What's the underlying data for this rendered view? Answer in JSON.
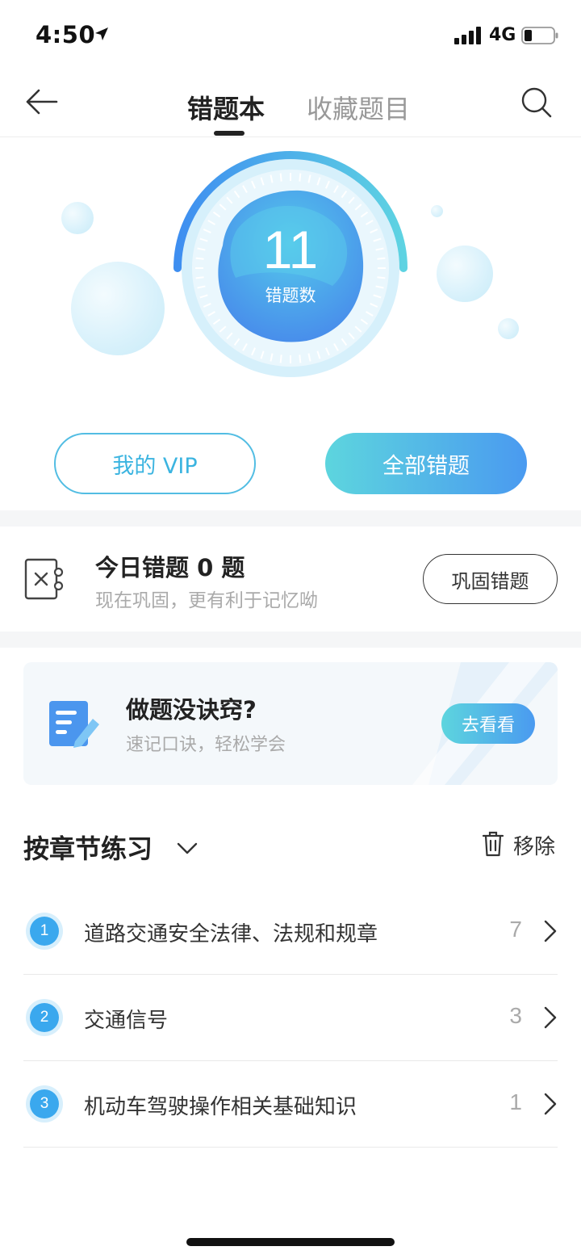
{
  "status_bar": {
    "time": "4:50",
    "network": "4G"
  },
  "nav": {
    "tab_active": "错题本",
    "tab_inactive": "收藏题目"
  },
  "hero": {
    "count": "11",
    "count_label": "错题数",
    "vip_button": "我的 VIP",
    "all_button": "全部错题"
  },
  "today": {
    "title": "今日错题 0 题",
    "subtitle": "现在巩固，更有利于记忆呦",
    "button": "巩固错题"
  },
  "tips": {
    "title": "做题没诀窍?",
    "subtitle": "速记口诀，轻松学会",
    "button": "去看看"
  },
  "section": {
    "title": "按章节练习",
    "remove_label": "移除"
  },
  "chapters": [
    {
      "num": "1",
      "label": "道路交通安全法律、法规和规章",
      "count": "7"
    },
    {
      "num": "2",
      "label": "交通信号",
      "count": "3"
    },
    {
      "num": "3",
      "label": "机动车驾驶操作相关基础知识",
      "count": "1"
    }
  ],
  "colors": {
    "accent_blue": "#4a9af0",
    "accent_cyan": "#5dd5de",
    "vip_border": "#52bde3"
  }
}
